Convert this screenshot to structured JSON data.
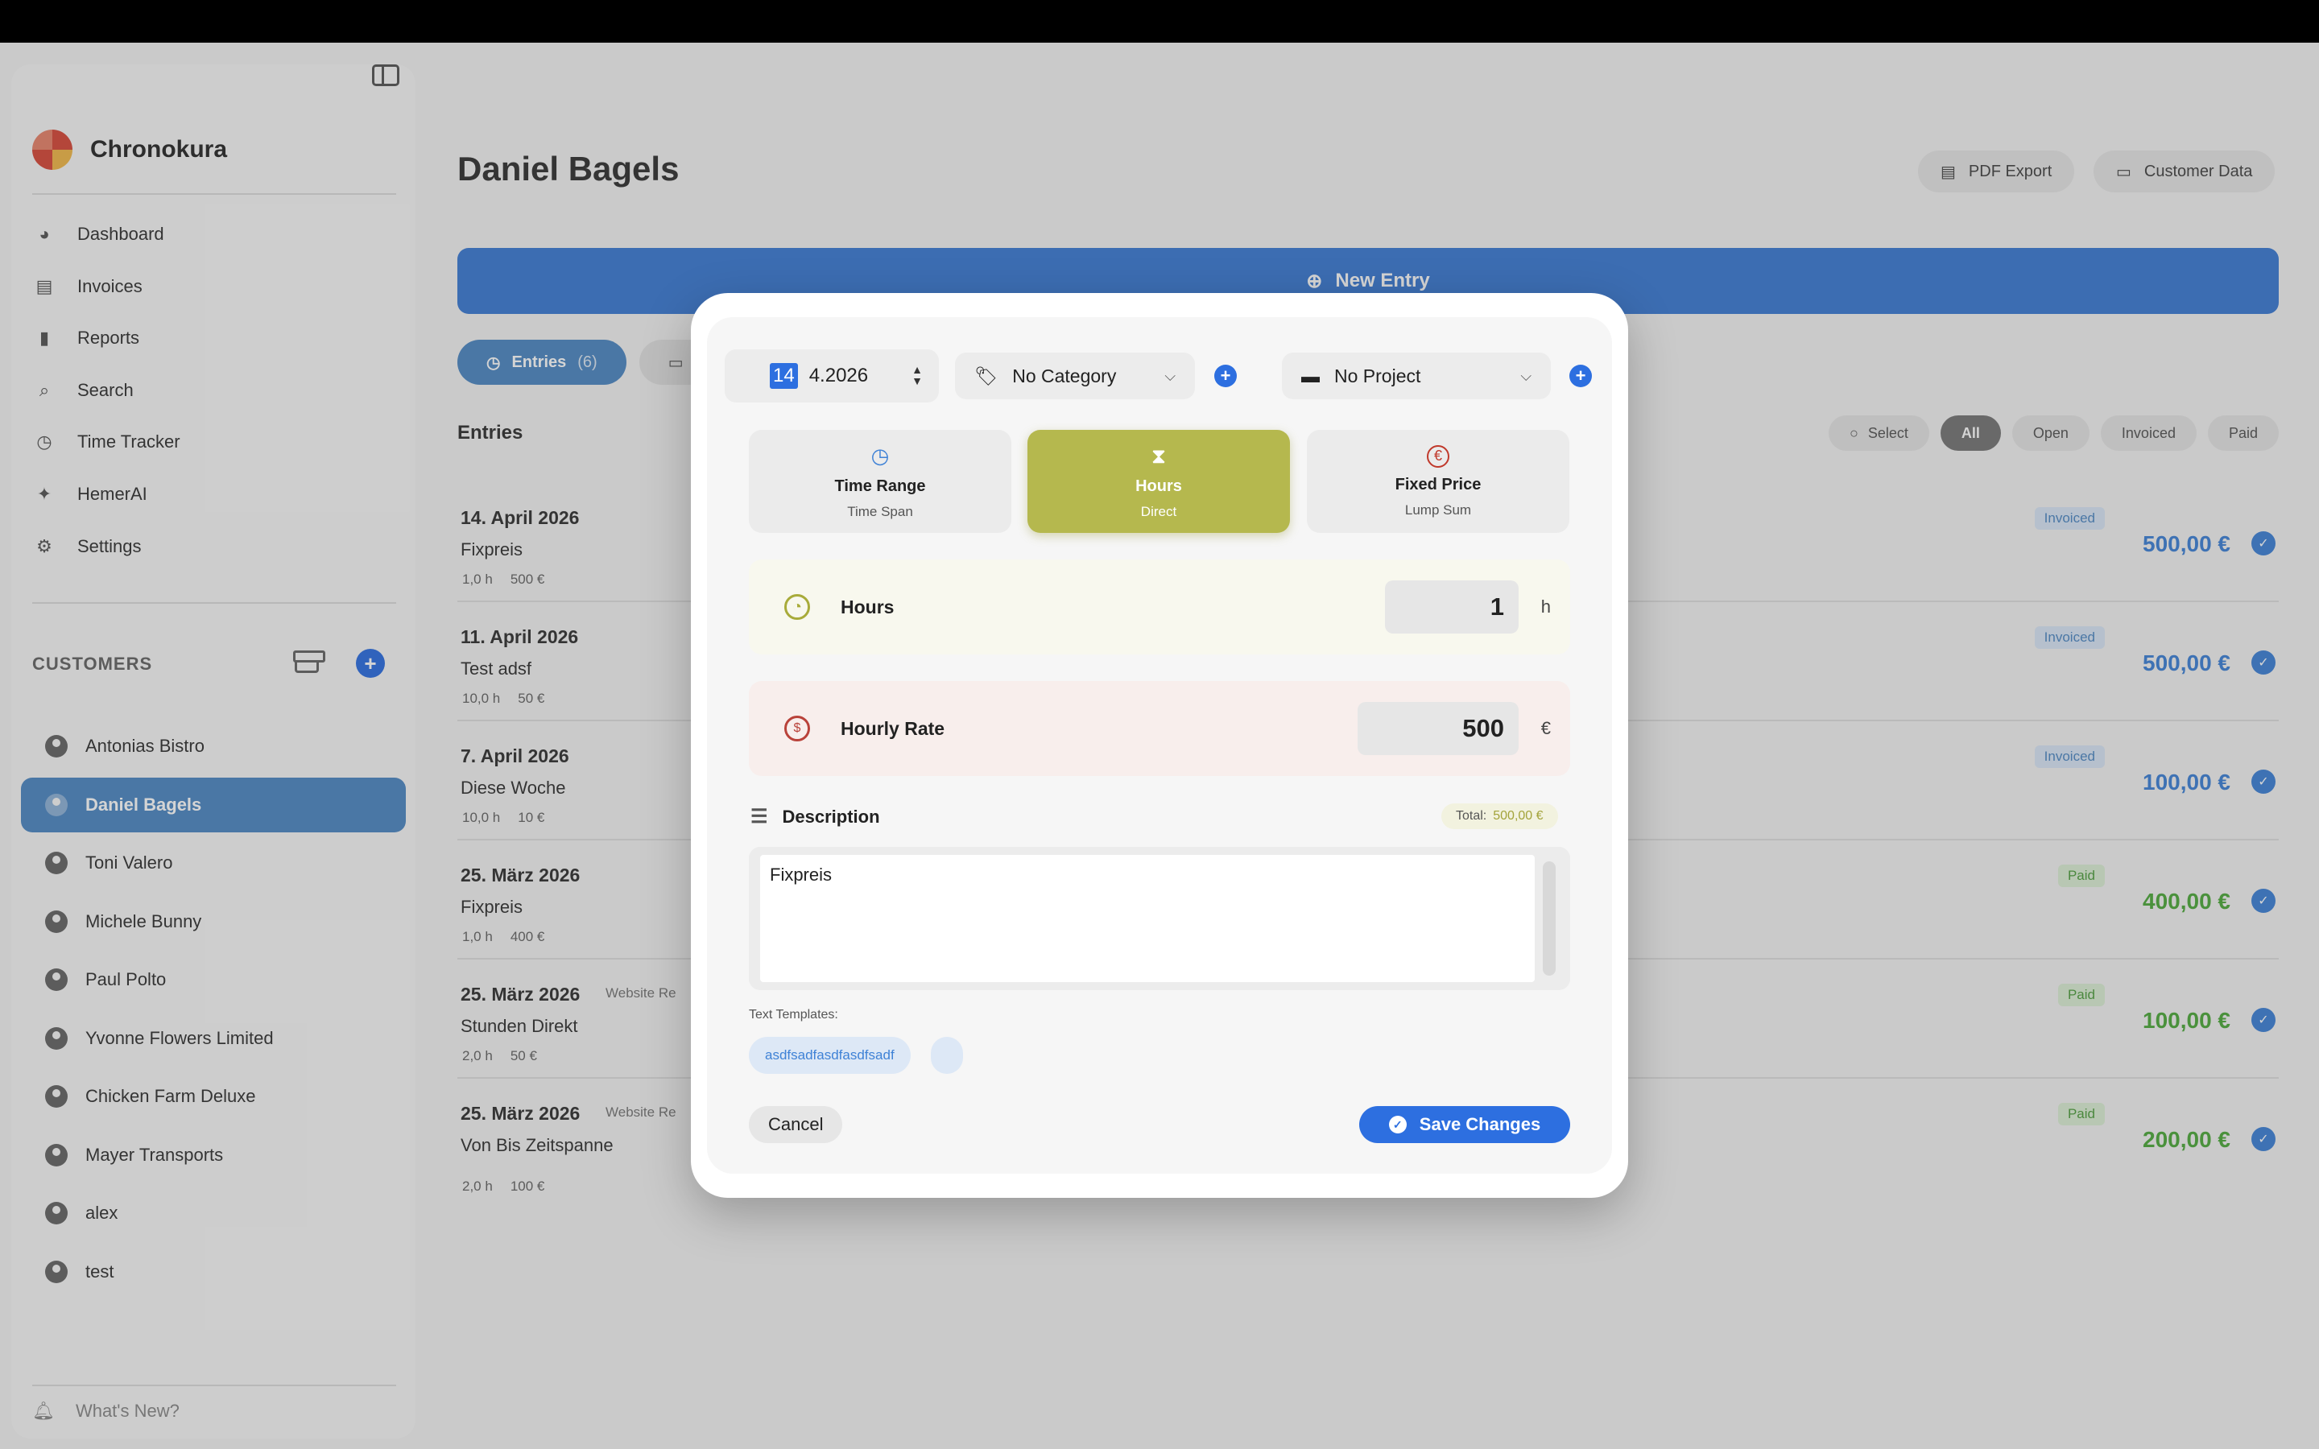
{
  "app": {
    "name": "Chronokura"
  },
  "sidebar": {
    "nav": [
      {
        "label": "Dashboard",
        "icon": "dashboard-icon"
      },
      {
        "label": "Invoices",
        "icon": "document-icon"
      },
      {
        "label": "Reports",
        "icon": "bar-chart-icon"
      },
      {
        "label": "Search",
        "icon": "search-icon"
      },
      {
        "label": "Time Tracker",
        "icon": "clock-icon"
      },
      {
        "label": "HemerAI",
        "icon": "sparkle-icon"
      },
      {
        "label": "Settings",
        "icon": "gear-icon"
      }
    ],
    "customers_heading": "CUSTOMERS",
    "customers": [
      "Antonias Bistro",
      "Daniel Bagels",
      "Toni Valero",
      "Michele Bunny",
      "Paul Polto",
      "Yvonne Flowers Limited",
      "Chicken Farm Deluxe",
      "Mayer Transports",
      "alex",
      "test"
    ],
    "selected_customer": "Daniel Bagels",
    "whats_new": "What's New?"
  },
  "main": {
    "title": "Daniel Bagels",
    "pdf_export": "PDF Export",
    "customer_data": "Customer Data",
    "new_entry": "New Entry",
    "tabs": [
      {
        "label": "Entries",
        "count": "(6)"
      }
    ],
    "entries_heading": "Entries",
    "filters": {
      "select": "Select",
      "options": [
        "All",
        "Open",
        "Invoiced",
        "Paid"
      ],
      "active": "All"
    },
    "entries": [
      {
        "date": "14. April 2026",
        "desc": "Fixpreis",
        "hours": "1,0 h",
        "rate": "500 €",
        "project": "",
        "status": "Invoiced",
        "amount": "500,00 €"
      },
      {
        "date": "11. April 2026",
        "desc": "Test adsf",
        "hours": "10,0 h",
        "rate": "50 €",
        "project": "",
        "status": "Invoiced",
        "amount": "500,00 €"
      },
      {
        "date": "7. April 2026",
        "desc": "Diese Woche",
        "hours": "10,0 h",
        "rate": "10 €",
        "project": "",
        "status": "Invoiced",
        "amount": "100,00 €"
      },
      {
        "date": "25. März 2026",
        "desc": "Fixpreis",
        "hours": "1,0 h",
        "rate": "400 €",
        "project": "",
        "status": "Paid",
        "amount": "400,00 €"
      },
      {
        "date": "25. März 2026",
        "desc": "Stunden Direkt",
        "hours": "2,0 h",
        "rate": "50 €",
        "project": "Website Re",
        "status": "Paid",
        "amount": "100,00 €"
      },
      {
        "date": "25. März 2026",
        "desc": "Von Bis Zeitspanne",
        "hours": "2,0 h",
        "rate": "100 €",
        "project": "Website Re",
        "status": "Paid",
        "amount": "200,00 €"
      }
    ]
  },
  "modal": {
    "date": {
      "day": "14",
      "rest": "4.2026"
    },
    "category": "No Category",
    "project": "No Project",
    "modes": [
      {
        "title": "Time Range",
        "subtitle": "Time Span"
      },
      {
        "title": "Hours",
        "subtitle": "Direct"
      },
      {
        "title": "Fixed Price",
        "subtitle": "Lump Sum"
      }
    ],
    "active_mode": "Hours",
    "hours": {
      "label": "Hours",
      "value": "1",
      "unit": "h"
    },
    "rate": {
      "label": "Hourly Rate",
      "value": "500",
      "unit": "€"
    },
    "description": {
      "label": "Description",
      "value": "Fixpreis"
    },
    "total": {
      "label": "Total:",
      "value": "500,00 €"
    },
    "templates": {
      "label": "Text Templates:",
      "items": [
        "asdfsadfasdfasdfsadf",
        ""
      ]
    },
    "cancel": "Cancel",
    "save": "Save Changes"
  },
  "colors": {
    "accent": "#2d6fe0",
    "selected": "#4f88c3",
    "hours_mode": "#b5b84e",
    "invoiced": "#3f82d6",
    "paid": "#4faa3d"
  }
}
